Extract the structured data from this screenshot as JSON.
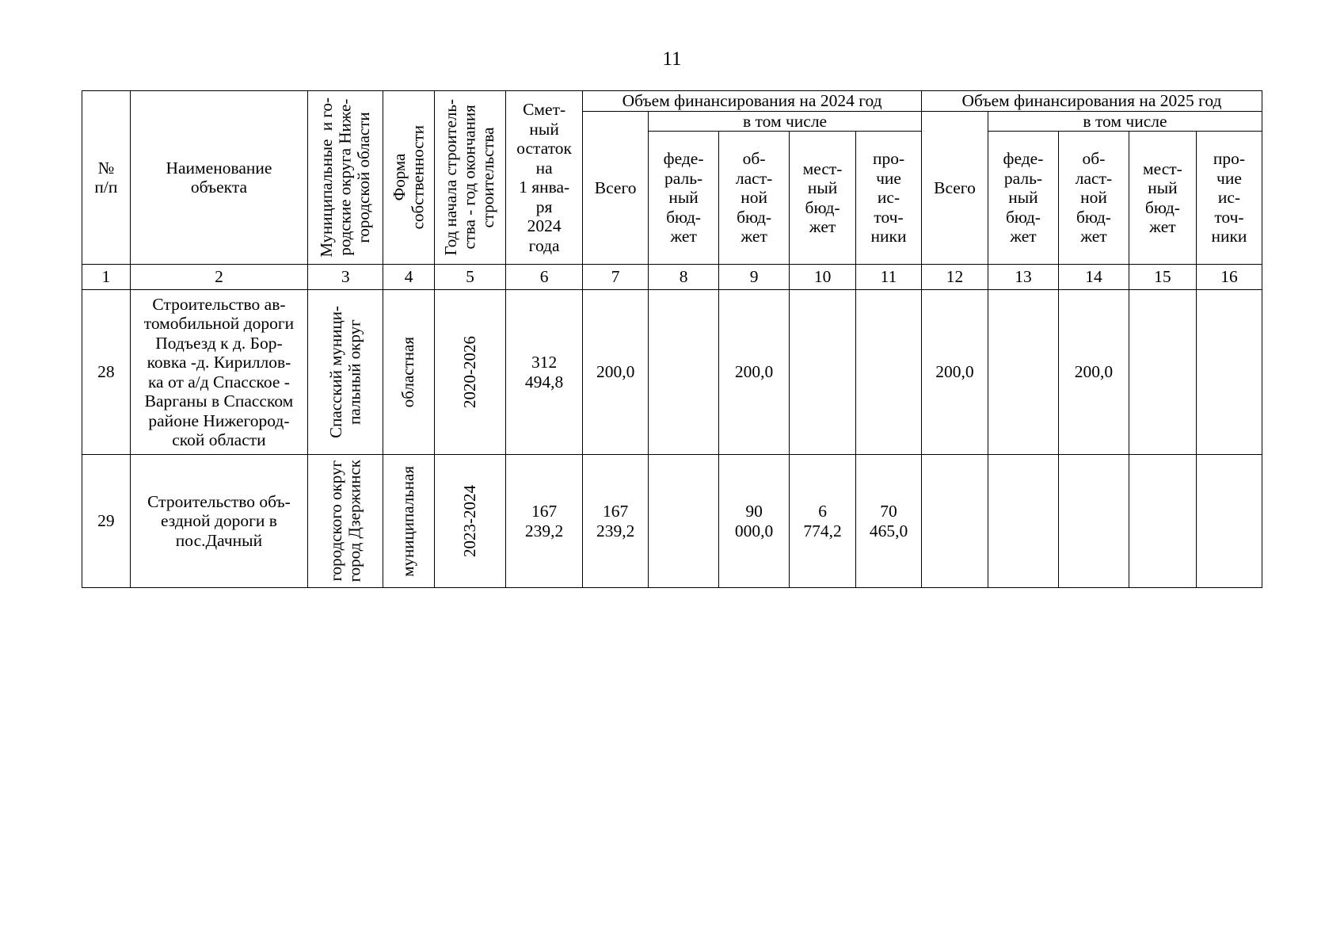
{
  "page": {
    "number": "11"
  },
  "table": {
    "headers": {
      "col_no": "№\nп/п",
      "col_object": "Наименование\nобъекта",
      "col_municipal": "Муниципальные  и го-\nродские округа Ниже-\nгородской области",
      "col_ownership": "Форма\nсобственности",
      "col_years": "Год начала строитель-\nства - год окончания\nстроительства",
      "col_estimate": "Смет-\nный\nостаток\nна\n1 янва-\nря\n2024\nгода",
      "group_2024": "Объем финансирования на 2024 год",
      "group_2025": "Объем финансирования на 2025 год",
      "subgroup": "в том числе",
      "total": "Всего",
      "federal": "феде-\nраль-\nный\nбюд-\nжет",
      "regional": "об-\nласт-\nной\nбюд-\nжет",
      "local": "мест-\nный\nбюд-\nжет",
      "other": "про-\nчие\nис-\nточ-\nники"
    },
    "column_numbers": [
      "1",
      "2",
      "3",
      "4",
      "5",
      "6",
      "7",
      "8",
      "9",
      "10",
      "11",
      "12",
      "13",
      "14",
      "15",
      "16"
    ],
    "rows": [
      {
        "no": "28",
        "object": "Строительство ав-\nтомобильной дороги\nПодъезд к д. Бор-\nковка -д. Кириллов-\nка от а/д Спасское -\nВарганы в Спасском\nрайоне Нижегород-\nской области",
        "municipal": "Спасский муници-\nпальный округ",
        "ownership": "областная",
        "years": "2020-2026",
        "estimate": "312\n494,8",
        "y2024_total": "200,0",
        "y2024_federal": "",
        "y2024_regional": "200,0",
        "y2024_local": "",
        "y2024_other": "",
        "y2025_total": "200,0",
        "y2025_federal": "",
        "y2025_regional": "200,0",
        "y2025_local": "",
        "y2025_other": ""
      },
      {
        "no": "29",
        "object": "Строительство объ-\nездной дороги в\nпос.Дачный",
        "municipal": "городского округ\nгород Дзержинск",
        "ownership": "муниципальная",
        "years": "2023-2024",
        "estimate": "167\n239,2",
        "y2024_total": "167\n239,2",
        "y2024_federal": "",
        "y2024_regional": "90\n000,0",
        "y2024_local": "6\n774,2",
        "y2024_other": "70\n465,0",
        "y2025_total": "",
        "y2025_federal": "",
        "y2025_regional": "",
        "y2025_local": "",
        "y2025_other": ""
      }
    ]
  }
}
